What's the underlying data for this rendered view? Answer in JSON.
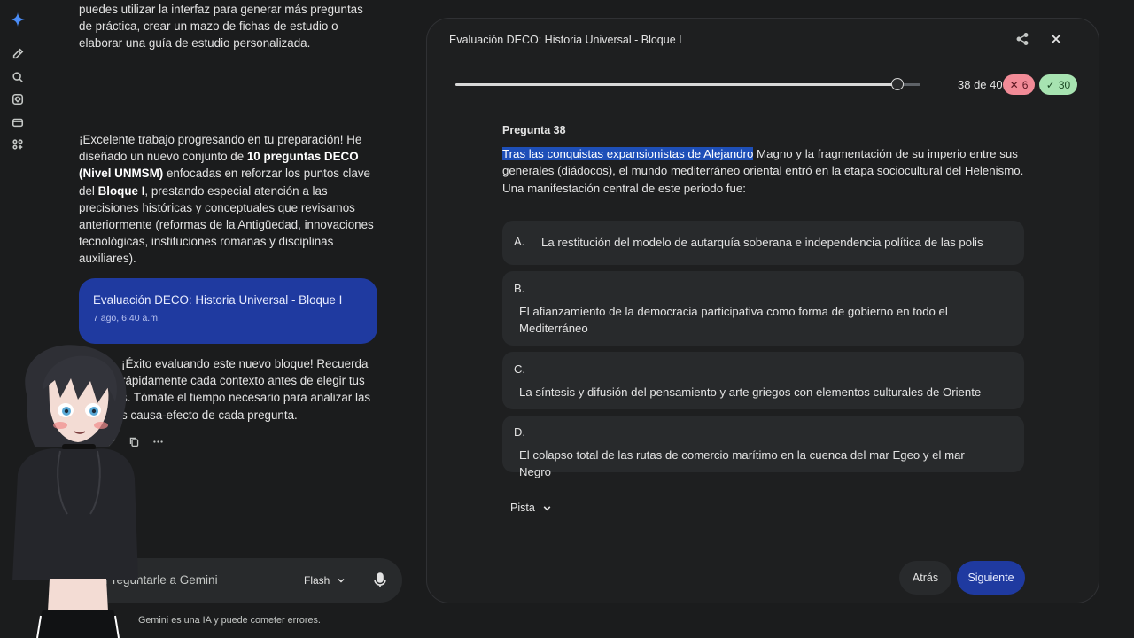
{
  "chat": {
    "intro_lines": [
      "puedes utilizar la interfaz para generar más preguntas",
      "de práctica, crear un mazo de fichas de estudio o",
      "elaborar una guía de estudio personalizada."
    ],
    "reply": {
      "p1": "¡Excelente trabajo progresando en tu preparación! He",
      "p2a": "diseñado un nuevo conjunto de ",
      "p2b": "10 preguntas DECO",
      "p3a": "(Nivel UNMSM)",
      "p3b": " enfocadas en reforzar los puntos clave",
      "p4a": "del ",
      "p4b": "Bloque I",
      "p4c": ", prestando especial atención a las",
      "p5": "precisiones históricas y conceptuales que revisamos",
      "p6": "anteriormente (reformas de la Antigüedad, innovaciones",
      "p7": "tecnológicas, instituciones romanas y disciplinas",
      "p8": "auxiliares)."
    },
    "card": {
      "title": "Evaluación DECO: Historia Universal - Bloque I",
      "date": "7 ago, 6:40 a.m."
    },
    "closing_lines": [
      "¡Éxito evaluando este nuevo bloque! Recuerda",
      "rápidamente cada contexto antes de elegir tus",
      "s. Tómate el tiempo necesario para analizar las",
      "s causa-efecto de cada pregunta."
    ],
    "prompt_placeholder": "Pregúntarle a Gemini",
    "model": "Flash",
    "disclaimer": "Gemini es una IA y puede cometer errores."
  },
  "quiz": {
    "title": "Evaluación DECO: Historia Universal - Bloque I",
    "progress": {
      "current": 38,
      "total": 40,
      "label": "38 de 40"
    },
    "wrong_count": "6",
    "right_count": "30",
    "question_label": "Pregunta 38",
    "question_highlight": "Tras las conquistas expansionistas de Alejandro",
    "question_rest": " Magno y la fragmentación de su imperio entre sus generales (diádocos), el mundo mediterráneo oriental entró en la etapa sociocultural del Helenismo. Una manifestación central de este periodo fue:",
    "options": [
      {
        "letter": "A.",
        "text": "La restitución del modelo de autarquía soberana e independencia política de las polis"
      },
      {
        "letter": "B.",
        "text": "El afianzamiento de la democracia participativa como forma de gobierno en todo el Mediterráneo"
      },
      {
        "letter": "C.",
        "text": "La síntesis y difusión del pensamiento y arte griegos con elementos culturales de Oriente"
      },
      {
        "letter": "D.",
        "text": "El colapso total de las rutas de comercio marítimo en la cuenca del mar Egeo y el mar Negro"
      }
    ],
    "hint_label": "Pista",
    "back_label": "Atrás",
    "next_label": "Siguiente"
  },
  "icons": [
    "gemini-spark-icon",
    "new-chat-icon",
    "search-icon",
    "gems-icon",
    "library-icon",
    "apps-icon",
    "share-icon",
    "close-icon",
    "chevron-down-icon",
    "mic-icon",
    "edit-icon",
    "copy-icon",
    "more-icon"
  ],
  "colors": {
    "accent": "#1f3aa0",
    "highlight": "#1e4fb8",
    "wrong_badge": "#f28b97",
    "right_badge": "#a7e3b1"
  }
}
